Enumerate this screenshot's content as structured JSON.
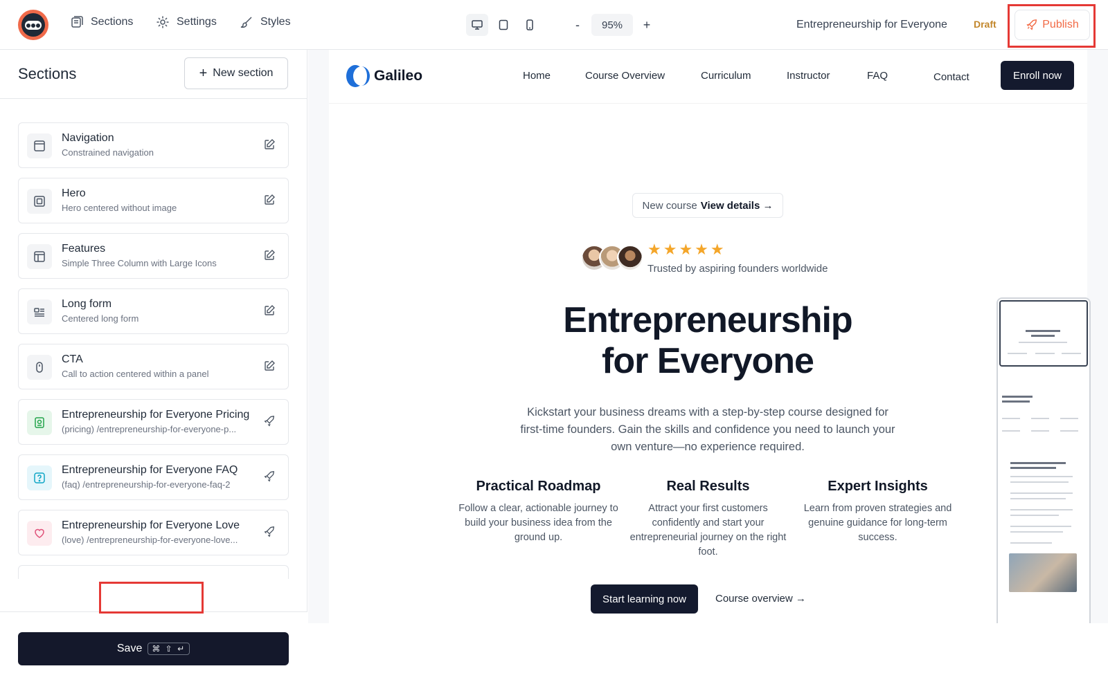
{
  "topbar": {
    "nav": [
      {
        "label": "Sections",
        "icon": "sections-icon"
      },
      {
        "label": "Settings",
        "icon": "gear-icon"
      },
      {
        "label": "Styles",
        "icon": "brush-icon"
      }
    ],
    "devices": [
      "desktop-icon",
      "tablet-icon",
      "mobile-icon"
    ],
    "zoom": {
      "minus": "-",
      "value": "95%",
      "plus": "+"
    },
    "project_title": "Entrepreneurship for Everyone",
    "status": "Draft",
    "publish_label": "Publish"
  },
  "sidebar": {
    "title": "Sections",
    "new_section_label": "New section",
    "items": [
      {
        "name": "Navigation",
        "sub": "Constrained navigation",
        "icon": "layout-icon",
        "action": "edit-icon"
      },
      {
        "name": "Hero",
        "sub": "Hero centered without image",
        "icon": "square-icon",
        "action": "edit-icon"
      },
      {
        "name": "Features",
        "sub": "Simple Three Column with Large Icons",
        "icon": "columns-icon",
        "action": "edit-icon"
      },
      {
        "name": "Long form",
        "sub": "Centered long form",
        "icon": "form-icon",
        "action": "edit-icon"
      },
      {
        "name": "CTA",
        "sub": "Call to action centered within a panel",
        "icon": "mouse-icon",
        "action": "edit-icon"
      },
      {
        "name": "Entrepreneurship for Everyone Pricing",
        "sub": "(pricing) /entrepreneurship-for-everyone-p...",
        "icon": "pricing-icon",
        "action": "rocket-icon"
      },
      {
        "name": "Entrepreneurship for Everyone FAQ",
        "sub": "(faq) /entrepreneurship-for-everyone-faq-2",
        "icon": "help-icon",
        "action": "rocket-icon"
      },
      {
        "name": "Entrepreneurship for Everyone Love",
        "sub": "(love) /entrepreneurship-for-everyone-love...",
        "icon": "heart-icon",
        "action": "rocket-icon"
      }
    ],
    "save_label": "Save",
    "save_shortcut": "⌘ ⇧ ↵"
  },
  "preview": {
    "brand": "Galileo",
    "links": [
      "Home",
      "Course Overview",
      "Curriculum",
      "Instructor",
      "FAQ",
      "Contact"
    ],
    "enroll_label": "Enroll now",
    "pill_prefix": "New course",
    "pill_link": "View details →",
    "stars": "★★★★★",
    "trusted": "Trusted by aspiring founders worldwide",
    "headline_line1": "Entrepreneurship",
    "headline_line2": "for Everyone",
    "lead": "Kickstart your business dreams with a step-by-step course designed for first-time founders. Gain the skills and confidence you need to launch your own venture—no experience required.",
    "features": [
      {
        "title": "Practical Roadmap",
        "text": "Follow a clear, actionable journey to build your business idea from the ground up."
      },
      {
        "title": "Real Results",
        "text": "Attract your first customers confidently and start your entrepreneurial journey on the right foot."
      },
      {
        "title": "Expert Insights",
        "text": "Learn from proven strategies and genuine guidance for long-term success."
      }
    ],
    "cta_primary": "Start learning now",
    "cta_secondary": "Course overview →"
  },
  "colors": {
    "accent": "#f26a45",
    "dark_button": "#141a2e",
    "highlight": "#e53935",
    "brand_blue": "#1e6fd9",
    "star": "#f4a62a",
    "draft": "#c2872c"
  }
}
